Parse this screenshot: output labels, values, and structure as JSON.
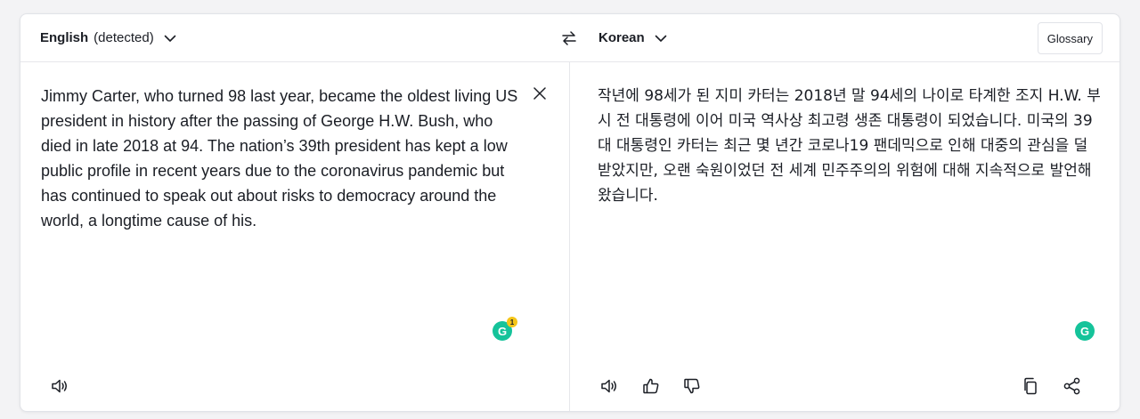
{
  "source_lang": {
    "name": "English",
    "detected_label": "(detected)",
    "icon": "chevron-down-icon"
  },
  "swap": {
    "icon": "swap-arrows-icon"
  },
  "target_lang": {
    "name": "Korean",
    "icon": "chevron-down-icon"
  },
  "glossary_label": "Glossary",
  "source_text": "Jimmy Carter, who turned 98 last year, became the oldest living US president in history after the passing of George H.W. Bush, who died in late 2018 at 94. The nation’s 39th president has kept a low public profile in recent years due to the coronavirus pandemic but has continued to speak out about risks to democracy around the world, a longtime cause of his.",
  "target_text": "작년에 98세가 된 지미 카터는 2018년 말 94세의 나이로 타계한 조지 H.W. 부시 전 대통령에 이어 미국 역사상 최고령 생존 대통령이 되었습니다. 미국의 39대 대통령인 카터는 최근 몇 년간 코로나19 팬데믹으로 인해 대중의 관심을 덜 받았지만, 오랜 숙원이었던 전 세계 민주주의의 위험에 대해 지속적으로 발언해 왔습니다.",
  "grammarly": {
    "letter": "G",
    "source_badge_count": "1",
    "color": "#15c39a",
    "badge_color": "#f5c518"
  },
  "icons": {
    "clear": "close-icon",
    "source_listen": "speaker-icon",
    "target_listen": "speaker-icon",
    "thumbs_up": "thumbs-up-icon",
    "thumbs_down": "thumbs-down-icon",
    "copy": "copy-icon",
    "share": "share-icon"
  }
}
